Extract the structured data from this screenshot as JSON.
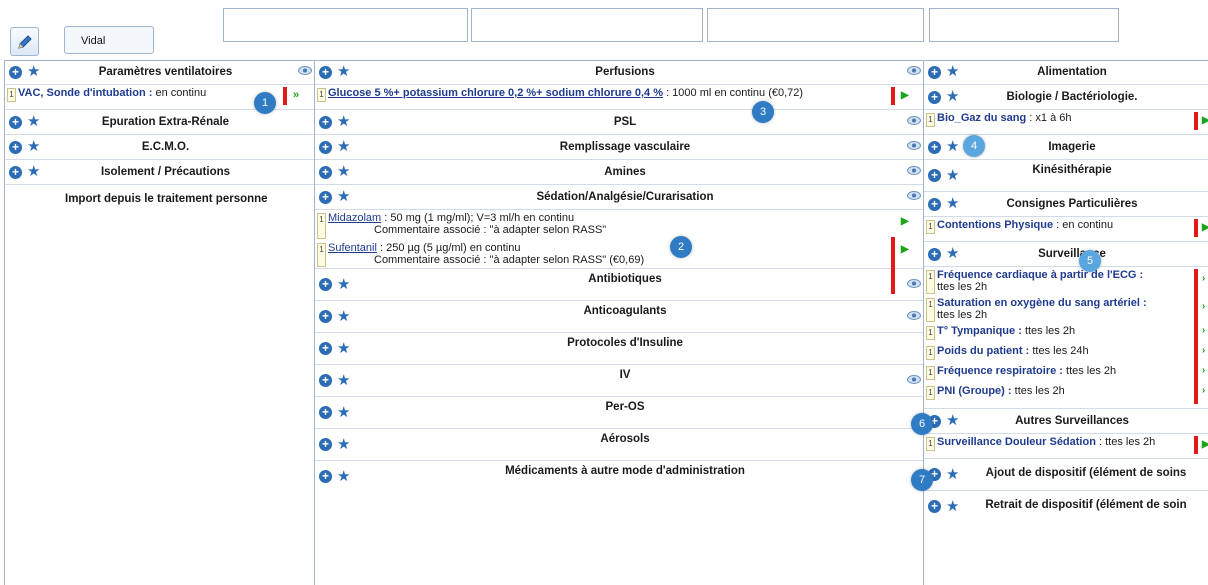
{
  "toolbar": {
    "vidal_label": "Vidal"
  },
  "col1": {
    "sections": [
      "Paramètres ventilatoires",
      "Epuration Extra-Rénale",
      "E.C.M.O.",
      "Isolement / Précautions"
    ],
    "vac_name": "VAC, Sonde d'intubation",
    "vac_sep": " : ",
    "vac_detail": " en continu",
    "import_label": "Import depuis le traitement personne"
  },
  "col2": {
    "perfusions": "Perfusions",
    "glucose_name": "Glucose 5 %+ potassium chlorure 0,2 %+ sodium chlorure 0,4 %",
    "glucose_detail": " : 1000 ml  en continu (€0,72)",
    "psl": "PSL",
    "remplissage": "Remplissage vasculaire",
    "amines": "Amines",
    "sedation": "Sédation/Analgésie/Curarisation",
    "midazolam_name": "Midazolam",
    "midazolam_detail": " : 50 mg (1 mg/ml); V=3 ml/h  en continu",
    "midazolam_comment": "Commentaire associé : \"à adapter selon RASS\"",
    "sufentanil_name": "Sufentanil",
    "sufentanil_detail": " : 250 µg (5 µg/ml)  en continu",
    "sufentanil_comment": "Commentaire associé : \"à adapter selon RASS\" (€0,69)",
    "antibiotiques": "Antibiotiques",
    "anticoagulants": "Anticoagulants",
    "insuline": "Protocoles d'Insuline",
    "iv": "IV",
    "peros": "Per-OS",
    "aerosols": "Aérosols",
    "autres_modes": "Médicaments à autre mode d'administration"
  },
  "col3": {
    "alimentation": "Alimentation",
    "biologie": "Biologie / Bactériologie.",
    "bio_name": "Bio_Gaz du sang",
    "bio_detail": " : x1 à 6h",
    "imagerie": "Imagerie",
    "kine": "Kinésithérapie",
    "consignes": "Consignes Particulières",
    "contentions_name": "Contentions Physique",
    "contentions_detail": " :  en continu",
    "surveillance": "Surveillance",
    "surv_items": [
      {
        "name": "Fréquence cardiaque à partir de l'ECG",
        "sep": " :",
        "detail": "ttes les 2h"
      },
      {
        "name": "Saturation en oxygène du sang artériel",
        "sep": " :",
        "detail": "ttes les 2h"
      },
      {
        "name": "T° Tympanique",
        "sep": " :",
        "detail": " ttes les 2h"
      },
      {
        "name": "Poids du patient",
        "sep": " :",
        "detail": " ttes les 24h"
      },
      {
        "name": "Fréquence respiratoire",
        "sep": " :",
        "detail": " ttes les 2h"
      },
      {
        "name": "PNI (Groupe)",
        "sep": " :",
        "detail": " ttes les 2h"
      }
    ],
    "autres_surv": "Autres Surveillances",
    "douleur_name": "Surveillance Douleur Sédation",
    "douleur_detail": " :  ttes les 2h",
    "ajout": "Ajout de dispositif (élément de soins",
    "retrait": "Retrait de dispositif (élément de soin"
  },
  "callouts": [
    "1",
    "2",
    "3",
    "4",
    "5",
    "6",
    "7"
  ],
  "badge": "1",
  "icons": {
    "pen": "pencil-icon",
    "plus": "plus-circle-icon",
    "star": "star-icon",
    "eye": "eye-icon",
    "arrow": "play-arrow-icon"
  },
  "colors": {
    "accent": "#2b6cb5",
    "link": "#1f3b8f",
    "alert": "#e11919",
    "go": "#1aa51a"
  }
}
